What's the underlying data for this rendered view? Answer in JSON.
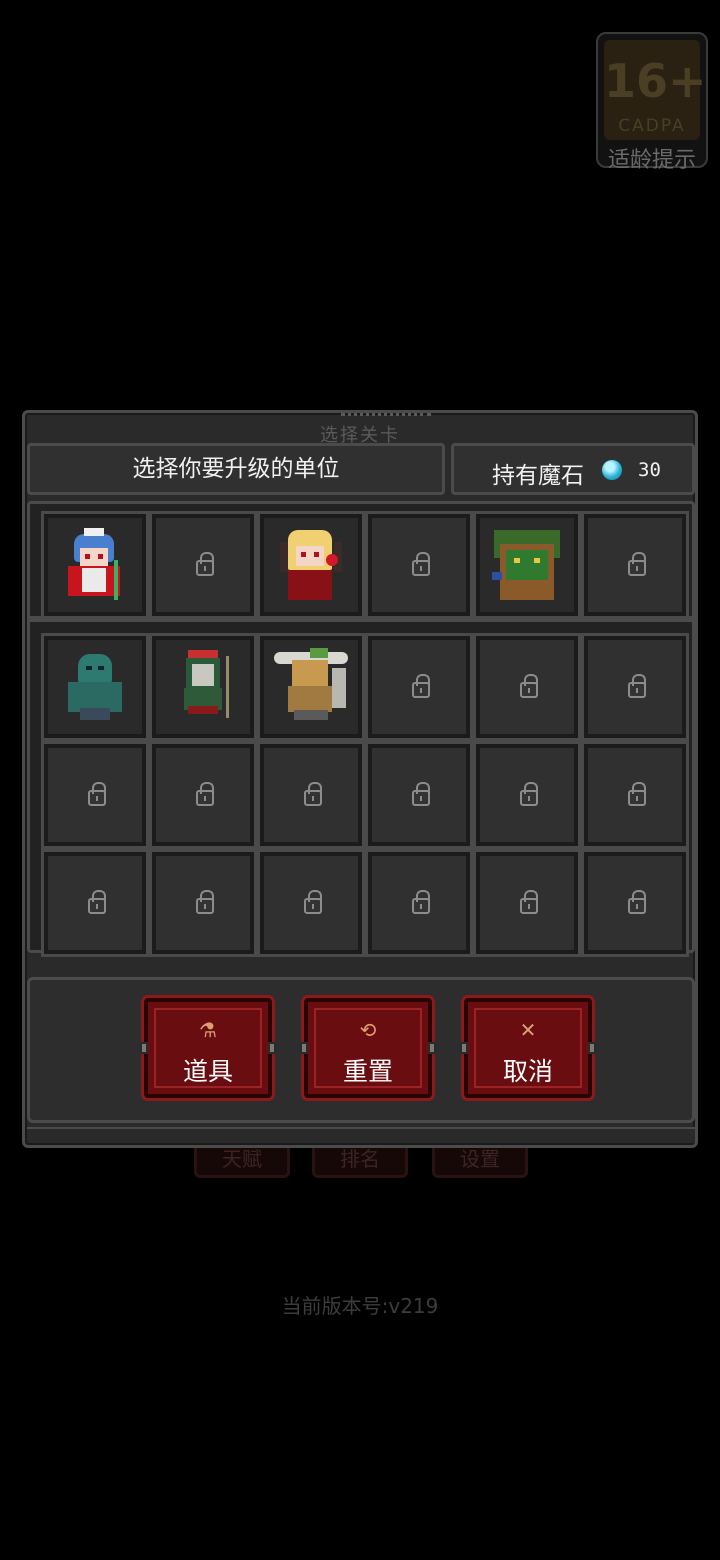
{
  "age_badge": {
    "rating": "16+",
    "org": "CADPA",
    "hint": "适龄提示"
  },
  "background": {
    "buttons": [
      "天赋",
      "排名",
      "设置"
    ],
    "version": "当前版本号:v219"
  },
  "dialog": {
    "title": "选择关卡",
    "header": {
      "prompt": "选择你要升级的单位",
      "hold_label": "持有魔石",
      "gem_count": "30"
    },
    "units_row": [
      {
        "state": "unit",
        "name": "ice-princess"
      },
      {
        "state": "locked"
      },
      {
        "state": "unit",
        "name": "blonde-demon"
      },
      {
        "state": "locked"
      },
      {
        "state": "unit",
        "name": "treant"
      },
      {
        "state": "locked"
      }
    ],
    "grid_rows": [
      [
        {
          "state": "unit",
          "name": "green-zombie"
        },
        {
          "state": "unit",
          "name": "masked-goblin"
        },
        {
          "state": "unit",
          "name": "viking-warrior"
        },
        {
          "state": "locked"
        },
        {
          "state": "locked"
        },
        {
          "state": "locked"
        }
      ],
      [
        {
          "state": "locked"
        },
        {
          "state": "locked"
        },
        {
          "state": "locked"
        },
        {
          "state": "locked"
        },
        {
          "state": "locked"
        },
        {
          "state": "locked"
        }
      ],
      [
        {
          "state": "locked"
        },
        {
          "state": "locked"
        },
        {
          "state": "locked"
        },
        {
          "state": "locked"
        },
        {
          "state": "locked"
        },
        {
          "state": "locked"
        }
      ]
    ],
    "actions": [
      {
        "label": "道具",
        "icon": "potion-icon",
        "glyph": "⚗"
      },
      {
        "label": "重置",
        "icon": "refresh-icon",
        "glyph": "⟲"
      },
      {
        "label": "取消",
        "icon": "close-icon",
        "glyph": "✕"
      }
    ]
  },
  "colors": {
    "accent_red": "#6a0d10",
    "gem": "#2fb7d8",
    "panel": "#2a2a2a"
  }
}
